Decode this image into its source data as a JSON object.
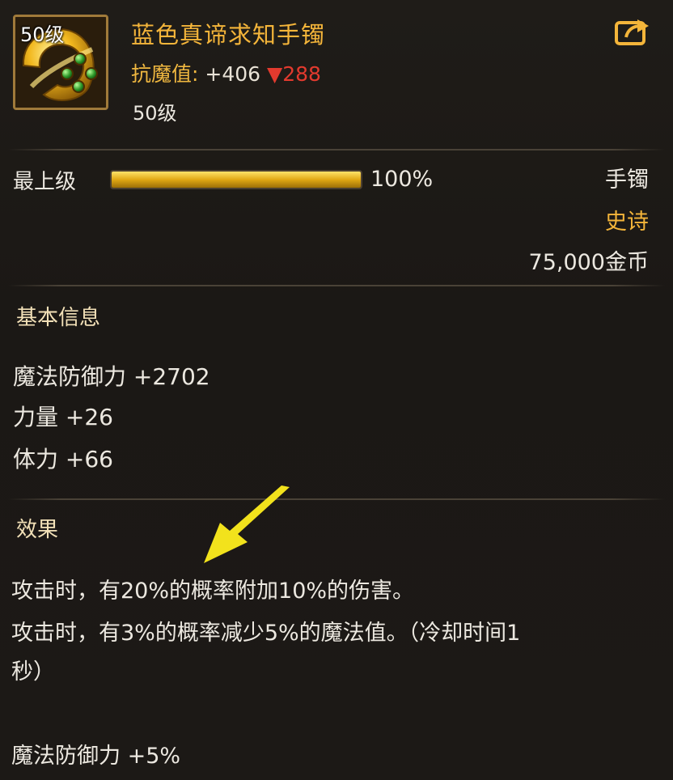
{
  "item": {
    "level_badge": "50级",
    "name": "蓝色真谛求知手镯",
    "resist_label": "抗魔值:",
    "resist_value": "+406",
    "resist_down_marker": "▼",
    "resist_down_value": "288",
    "required_level": "50级"
  },
  "icons": {
    "item_icon": "gold-bracelet-icon",
    "share_icon": "share-icon",
    "arrow": "yellow-pointer-arrow"
  },
  "upgrade": {
    "label": "最上级",
    "progress_percent": 100,
    "progress_text": "100%"
  },
  "meta": {
    "slot": "手镯",
    "rarity": "史诗",
    "price": "75,000金币"
  },
  "basic_info": {
    "heading": "基本信息",
    "stats": [
      "魔法防御力 +2702",
      "力量 +26",
      "体力 +66"
    ]
  },
  "effects": {
    "heading": "效果",
    "lines": [
      "攻击时，有20%的概率附加10%的伤害。",
      "攻击时，有3%的概率减少5%的魔法值。（冷却时间1",
      "秒）",
      "魔法防御力 +5%"
    ]
  },
  "colors": {
    "title_gold": "#f4b53a",
    "down_red": "#e23a2e",
    "background": "#1c1916",
    "arrow_yellow": "#f2e21c"
  }
}
